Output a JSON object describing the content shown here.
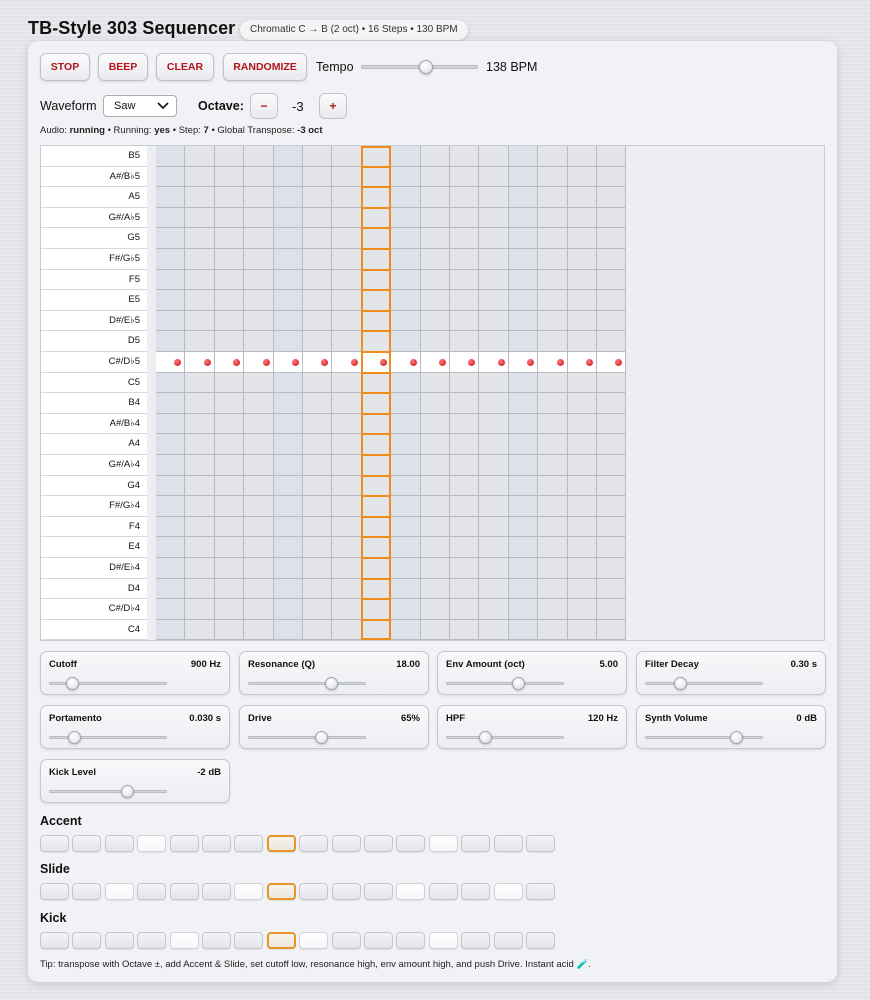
{
  "app": {
    "title": "TB-Style 303 Sequencer",
    "subtitle": "Chromatic C → B (2 oct) • 16 Steps • 130 BPM"
  },
  "toolbar": {
    "stop_label": "STOP",
    "beep_label": "BEEP",
    "clear_label": "CLEAR",
    "randomize_label": "RANDOMIZE",
    "tempo_label": "Tempo",
    "tempo_value": "138 BPM",
    "tempo_level": 0.55,
    "accent_color": "#b0161a"
  },
  "waveform": {
    "label": "Waveform",
    "selected": "Saw"
  },
  "octave": {
    "label": "Octave:",
    "minus_label": "−",
    "plus_label": "+",
    "value": "-3"
  },
  "status": {
    "audio_label": "Audio:",
    "audio_value": "running",
    "running_label": "Running:",
    "running_value": "yes",
    "step_label": "Step:",
    "step_value": "7",
    "transpose_label": "Global Transpose:",
    "transpose_value": "-3 oct",
    "sep": " • "
  },
  "grid": {
    "notes": [
      "B5",
      "A#/B♭5",
      "A5",
      "G#/A♭5",
      "G5",
      "F#/G♭5",
      "F5",
      "E5",
      "D#/E♭5",
      "D5",
      "C#/D♭5",
      "C5",
      "B4",
      "A#/B♭4",
      "A4",
      "G#/A♭4",
      "G4",
      "F#/G♭4",
      "F4",
      "E4",
      "D#/E♭4",
      "D4",
      "C#/D♭4",
      "C4"
    ],
    "steps": 16,
    "current_step": 7,
    "active_row": 10,
    "active_note": "C#/D♭5",
    "playhead_color": "#f08c1a",
    "note_color": "#c40e14",
    "beat_shade_color": "#dde1ea",
    "offbeat_color": "#e4e5e8"
  },
  "controls": [
    {
      "name": "Cutoff",
      "value": "900 Hz",
      "level": 0.15
    },
    {
      "name": "Resonance (Q)",
      "value": "18.00",
      "level": 0.72
    },
    {
      "name": "Env Amount (oct)",
      "value": "5.00",
      "level": 0.62
    },
    {
      "name": "Filter Decay",
      "value": "0.30 s",
      "level": 0.27
    },
    {
      "name": "Portamento",
      "value": "0.030 s",
      "level": 0.17
    },
    {
      "name": "Drive",
      "value": "65%",
      "level": 0.63
    },
    {
      "name": "HPF",
      "value": "120 Hz",
      "level": 0.3
    },
    {
      "name": "Synth Volume",
      "value": "0 dB",
      "level": 0.8
    },
    {
      "name": "Kick Level",
      "value": "-2 dB",
      "level": 0.68
    }
  ],
  "accent": {
    "title": "Accent",
    "on_steps": [
      3,
      12
    ]
  },
  "slide": {
    "title": "Slide",
    "on_steps": [
      2,
      6,
      11,
      14
    ]
  },
  "kick": {
    "title": "Kick",
    "on_steps": [
      4,
      8,
      12
    ]
  },
  "tip": "Tip: transpose with Octave ±, add Accent & Slide, set cutoff low, resonance high, env amount high, and push Drive. Instant acid 🧪."
}
